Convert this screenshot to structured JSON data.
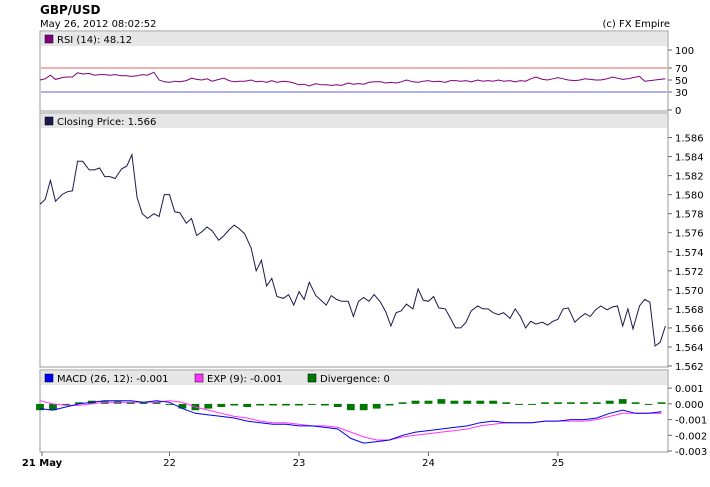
{
  "header": {
    "title": "GBP/USD",
    "timestamp": "May 26, 2012 08:02:52",
    "credit": "(c) FX Empire"
  },
  "rsi_panel": {
    "legend": "RSI (14): 48.12",
    "color": "#800080",
    "ticks": [
      "100",
      "70",
      "50",
      "30",
      "0"
    ],
    "tick_colors": {
      "70": "#cc3333",
      "30": "#3333cc"
    }
  },
  "price_panel": {
    "legend": "Closing Price: 1.566",
    "color": "#1a1a4d",
    "ticks": [
      "1.586",
      "1.584",
      "1.582",
      "1.580",
      "1.578",
      "1.576",
      "1.574",
      "1.572",
      "1.570",
      "1.568",
      "1.566",
      "1.564",
      "1.562"
    ]
  },
  "macd_panel": {
    "legend_macd": "MACD (26, 12): -0.001",
    "legend_exp": "EXP (9): -0.001",
    "legend_div": "Divergence: 0",
    "macd_color": "#0000ee",
    "exp_color": "#ff33ff",
    "div_color": "#007700",
    "ticks": [
      "0.001",
      "0.000",
      "-0.001",
      "-0.002",
      "-0.003"
    ]
  },
  "x_axis": {
    "labels": [
      "21 May",
      "22",
      "23",
      "24",
      "25"
    ]
  },
  "chart_data": [
    {
      "type": "line",
      "name": "RSI",
      "title": "RSI (14): 48.12",
      "ylim": [
        0,
        100
      ],
      "reference_lines": [
        70,
        30
      ],
      "x": [
        21.0,
        21.04,
        21.08,
        21.12,
        21.17,
        21.21,
        21.25,
        21.29,
        21.33,
        21.38,
        21.42,
        21.46,
        21.5,
        21.54,
        21.58,
        21.63,
        21.67,
        21.71,
        21.75,
        21.79,
        21.83,
        21.88,
        21.92,
        21.96,
        22.0,
        22.04,
        22.08,
        22.13,
        22.17,
        22.21,
        22.25,
        22.29,
        22.33,
        22.38,
        22.42,
        22.46,
        22.5,
        22.54,
        22.58,
        22.63,
        22.67,
        22.71,
        22.75,
        22.79,
        22.83,
        22.88,
        22.92,
        22.96,
        23.0,
        23.04,
        23.08,
        23.13,
        23.17,
        23.21,
        23.25,
        23.29,
        23.33,
        23.38,
        23.42,
        23.46,
        23.5,
        23.54,
        23.58,
        23.63,
        23.67,
        23.71,
        23.75,
        23.79,
        23.83,
        23.88,
        23.92,
        23.96,
        24.0,
        24.04,
        24.08,
        24.13,
        24.17,
        24.21,
        24.25,
        24.29,
        24.33,
        24.38,
        24.42,
        24.46,
        24.5,
        24.54,
        24.58,
        24.63,
        24.67,
        24.71,
        24.75,
        24.79,
        24.83,
        24.88,
        24.92,
        24.96,
        25.0,
        25.04,
        25.08,
        25.13,
        25.17,
        25.21,
        25.25,
        25.29,
        25.33,
        25.38,
        25.42,
        25.46,
        25.5,
        25.54,
        25.58,
        25.63,
        25.67,
        25.71,
        25.75,
        25.79,
        25.83
      ],
      "values": [
        50,
        52,
        58,
        51,
        54,
        55,
        55,
        62,
        60,
        61,
        58,
        59,
        59,
        58,
        59,
        57,
        57,
        56,
        57,
        59,
        58,
        63,
        50,
        47,
        46,
        48,
        47,
        49,
        53,
        51,
        50,
        52,
        48,
        51,
        53,
        49,
        47,
        48,
        48,
        50,
        47,
        48,
        46,
        49,
        46,
        48,
        47,
        45,
        42,
        43,
        40,
        44,
        42,
        42,
        41,
        42,
        41,
        45,
        43,
        44,
        43,
        46,
        47,
        47,
        45,
        46,
        45,
        47,
        50,
        47,
        46,
        48,
        49,
        47,
        48,
        46,
        49,
        49,
        48,
        49,
        47,
        50,
        48,
        49,
        48,
        50,
        48,
        49,
        47,
        49,
        48,
        52,
        55,
        51,
        50,
        52,
        54,
        52,
        50,
        49,
        50,
        52,
        51,
        50,
        50,
        52,
        55,
        53,
        51,
        52,
        54,
        56,
        48,
        49,
        50,
        51,
        52,
        51,
        53,
        50,
        48
      ]
    },
    {
      "type": "line",
      "name": "Closing Price",
      "title": "Closing Price: 1.566",
      "ylim": [
        1.562,
        1.587
      ],
      "x": [
        21.0,
        21.04,
        21.08,
        21.12,
        21.17,
        21.21,
        21.25,
        21.29,
        21.33,
        21.38,
        21.42,
        21.46,
        21.5,
        21.54,
        21.58,
        21.63,
        21.67,
        21.71,
        21.75,
        21.79,
        21.83,
        21.88,
        21.92,
        21.96,
        22.0,
        22.04,
        22.08,
        22.13,
        22.17,
        22.21,
        22.25,
        22.29,
        22.33,
        22.38,
        22.42,
        22.46,
        22.5,
        22.54,
        22.58,
        22.63,
        22.67,
        22.71,
        22.75,
        22.79,
        22.83,
        22.88,
        22.92,
        22.96,
        23.0,
        23.04,
        23.08,
        23.13,
        23.17,
        23.21,
        23.25,
        23.29,
        23.33,
        23.38,
        23.42,
        23.46,
        23.5,
        23.54,
        23.58,
        23.63,
        23.67,
        23.71,
        23.75,
        23.79,
        23.83,
        23.88,
        23.92,
        23.96,
        24.0,
        24.04,
        24.08,
        24.13,
        24.17,
        24.21,
        24.25,
        24.29,
        24.33,
        24.38,
        24.42,
        24.46,
        24.5,
        24.54,
        24.58,
        24.63,
        24.67,
        24.71,
        24.75,
        24.79,
        24.83,
        24.88,
        24.92,
        24.96,
        25.0,
        25.04,
        25.08,
        25.13,
        25.17,
        25.21,
        25.25,
        25.29,
        25.33,
        25.38,
        25.42,
        25.46,
        25.5,
        25.54,
        25.58,
        25.63,
        25.67,
        25.71,
        25.75,
        25.79,
        25.83
      ],
      "values": [
        1.579,
        1.5795,
        1.5815,
        1.5793,
        1.58,
        1.5803,
        1.5804,
        1.5835,
        1.5835,
        1.5826,
        1.5826,
        1.5828,
        1.5819,
        1.5819,
        1.5817,
        1.5827,
        1.583,
        1.5842,
        1.5797,
        1.578,
        1.5775,
        1.578,
        1.5777,
        1.58,
        1.58,
        1.5782,
        1.5781,
        1.577,
        1.5775,
        1.5757,
        1.5761,
        1.5766,
        1.5762,
        1.5752,
        1.5757,
        1.5763,
        1.5768,
        1.5764,
        1.5759,
        1.5744,
        1.572,
        1.5731,
        1.5704,
        1.5712,
        1.5693,
        1.5691,
        1.5695,
        1.5684,
        1.5698,
        1.569,
        1.5708,
        1.5694,
        1.5689,
        1.5684,
        1.5694,
        1.569,
        1.5688,
        1.5688,
        1.5672,
        1.5688,
        1.5692,
        1.5688,
        1.5695,
        1.5687,
        1.5677,
        1.5662,
        1.5676,
        1.5678,
        1.5685,
        1.568,
        1.5701,
        1.5689,
        1.5688,
        1.5693,
        1.5681,
        1.568,
        1.567,
        1.566,
        1.566,
        1.5666,
        1.5678,
        1.5683,
        1.568,
        1.568,
        1.5676,
        1.5674,
        1.5676,
        1.567,
        1.568,
        1.5672,
        1.566,
        1.5667,
        1.5664,
        1.5666,
        1.5663,
        1.5667,
        1.5669,
        1.568,
        1.5681,
        1.5666,
        1.5671,
        1.5675,
        1.5672,
        1.5679,
        1.5683,
        1.5679,
        1.5682,
        1.5683,
        1.5662,
        1.568,
        1.5659,
        1.5683,
        1.569,
        1.5687,
        1.5641,
        1.5645,
        1.5662
      ]
    },
    {
      "type": "line",
      "title": "MACD",
      "ylim": [
        -0.003,
        0.0012
      ],
      "x": [
        21.0,
        21.1,
        21.2,
        21.3,
        21.4,
        21.5,
        21.6,
        21.7,
        21.8,
        21.9,
        22.0,
        22.1,
        22.2,
        22.3,
        22.4,
        22.5,
        22.6,
        22.7,
        22.8,
        22.9,
        23.0,
        23.1,
        23.2,
        23.3,
        23.4,
        23.5,
        23.6,
        23.7,
        23.8,
        23.9,
        24.0,
        24.1,
        24.2,
        24.3,
        24.4,
        24.5,
        24.6,
        24.7,
        24.8,
        24.9,
        25.0,
        25.1,
        25.2,
        25.3,
        25.4,
        25.5,
        25.6,
        25.7,
        25.8
      ],
      "series": [
        {
          "name": "MACD (26, 12): -0.001",
          "values": [
            -0.0003,
            -0.0004,
            -0.0002,
            0.0,
            0.0001,
            0.0002,
            0.0002,
            0.0002,
            0.0001,
            0.0002,
            0.0001,
            -0.0003,
            -0.0006,
            -0.0007,
            -0.0008,
            -0.0009,
            -0.0011,
            -0.0012,
            -0.0013,
            -0.0013,
            -0.0014,
            -0.0014,
            -0.0015,
            -0.0016,
            -0.0022,
            -0.0025,
            -0.0024,
            -0.0023,
            -0.002,
            -0.0018,
            -0.0017,
            -0.0016,
            -0.0015,
            -0.0014,
            -0.0012,
            -0.0011,
            -0.0012,
            -0.0012,
            -0.0012,
            -0.0011,
            -0.0011,
            -0.001,
            -0.001,
            -0.0009,
            -0.0006,
            -0.0004,
            -0.0006,
            -0.0006,
            -0.0005
          ]
        },
        {
          "name": "EXP (9): -0.001",
          "values": [
            0.0002,
            0.0,
            -0.0001,
            -0.0001,
            0.0,
            0.0001,
            0.0001,
            0.0001,
            0.0001,
            0.0001,
            0.0002,
            0.0001,
            -0.0002,
            -0.0004,
            -0.0006,
            -0.0008,
            -0.0009,
            -0.0011,
            -0.0012,
            -0.0012,
            -0.0013,
            -0.0014,
            -0.0014,
            -0.0015,
            -0.0018,
            -0.0021,
            -0.0023,
            -0.0023,
            -0.0021,
            -0.002,
            -0.0019,
            -0.0018,
            -0.0017,
            -0.0016,
            -0.0014,
            -0.0013,
            -0.0012,
            -0.0012,
            -0.0012,
            -0.0011,
            -0.0011,
            -0.0011,
            -0.0011,
            -0.001,
            -0.0008,
            -0.0006,
            -0.0006,
            -0.0006,
            -0.0006
          ]
        },
        {
          "name": "Divergence: 0",
          "kind": "bar",
          "values": [
            -0.0004,
            -0.0004,
            -0.0001,
            0.0001,
            0.0002,
            0.0002,
            0.0002,
            0.0001,
            0.0001,
            0.0001,
            0.0,
            -0.0003,
            -0.0004,
            -0.0003,
            -0.0002,
            -0.0001,
            -0.0002,
            -0.0001,
            -0.0001,
            -0.0001,
            -0.0001,
            0.0,
            -0.0001,
            -0.0002,
            -0.0004,
            -0.0004,
            -0.0003,
            -0.0001,
            0.0001,
            0.0002,
            0.0002,
            0.0003,
            0.0002,
            0.0002,
            0.0002,
            0.0002,
            0.0001,
            0.0,
            0.0,
            0.0001,
            0.0001,
            0.0001,
            0.0001,
            0.0001,
            0.0002,
            0.0003,
            0.0001,
            0.0,
            0.0001
          ]
        }
      ]
    }
  ]
}
